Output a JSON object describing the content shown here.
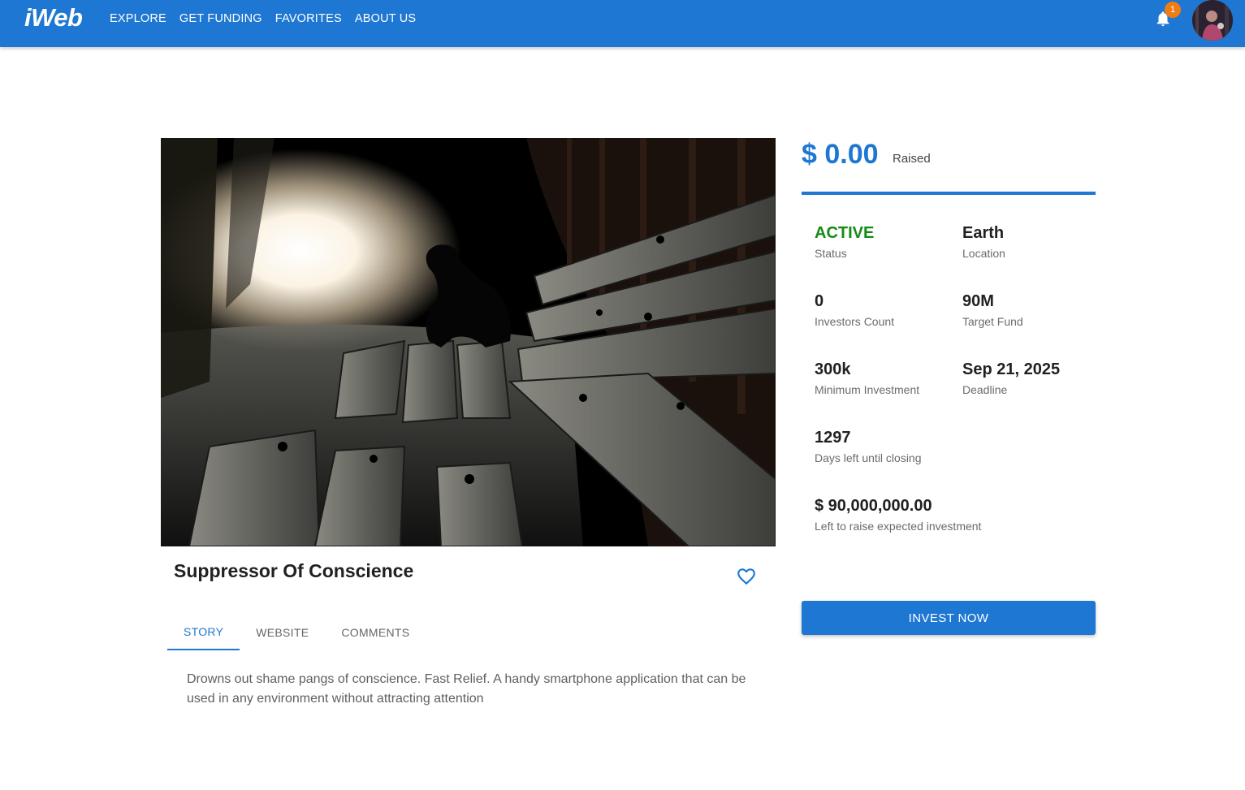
{
  "app": {
    "logo": "iWeb",
    "nav": [
      "EXPLORE",
      "GET FUNDING",
      "FAVORITES",
      "ABOUT US"
    ],
    "notification_count": "1"
  },
  "project": {
    "title": "Suppressor Of Conscience",
    "tabs": [
      "STORY",
      "WEBSITE",
      "COMMENTS"
    ],
    "active_tab": "STORY",
    "story": "Drowns out shame pangs of conscience. Fast Relief. A handy smartphone application that can be used in any environment without attracting attention"
  },
  "funding": {
    "raised_amount": "$ 0.00",
    "raised_label": "Raised",
    "progress_fraction": 0,
    "stats": {
      "status": {
        "value": "ACTIVE",
        "label": "Status"
      },
      "location": {
        "value": "Earth",
        "label": "Location"
      },
      "investors": {
        "value": "0",
        "label": "Investors Count"
      },
      "target": {
        "value": "90M",
        "label": "Target Fund"
      },
      "min_investment": {
        "value": "300k",
        "label": "Minimum Investment"
      },
      "deadline": {
        "value": "Sep 21, 2025",
        "label": "Deadline"
      },
      "days_left": {
        "value": "1297",
        "label": "Days left until closing"
      },
      "left_to_raise": {
        "value": "$ 90,000,000.00",
        "label": "Left to raise expected investment"
      }
    },
    "invest_button": "INVEST NOW"
  },
  "colors": {
    "primary": "#1e77d2",
    "status_active": "#168a16",
    "badge": "#f07c14"
  },
  "icons": {
    "bell": "bell-icon",
    "favorite": "heart-outline-icon"
  }
}
